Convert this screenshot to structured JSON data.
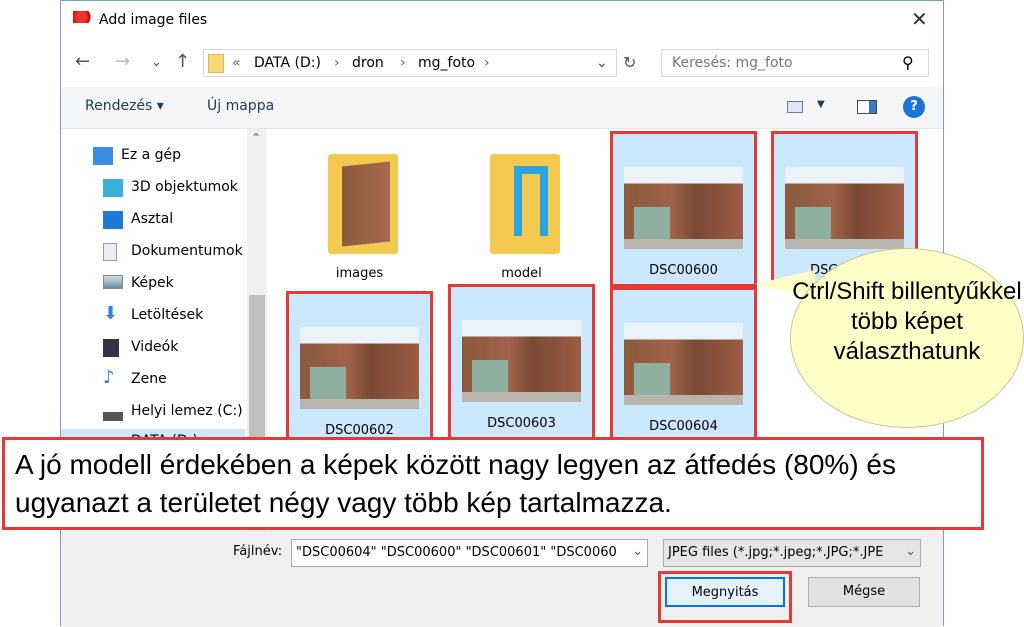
{
  "window": {
    "title": "Add image files",
    "close": "✕"
  },
  "nav": {
    "back": "←",
    "forward": "→",
    "recent": "⌄",
    "up": "↑",
    "breadcrumb": [
      "«",
      "DATA (D:)",
      "›",
      "dron",
      "›",
      "mg_foto",
      "›"
    ],
    "refresh": "↻",
    "dropdown": "⌄",
    "search_placeholder": "Keresés: mg_foto",
    "search_icon": "⚲"
  },
  "toolbar": {
    "organize": "Rendezés ▾",
    "new_folder": "Új mappa",
    "help": "?"
  },
  "sidebar": {
    "items": [
      {
        "label": "Ez a gép",
        "icon": "computer-icon"
      },
      {
        "label": "3D objektumok",
        "icon": "cube-icon"
      },
      {
        "label": "Asztal",
        "icon": "desktop-icon"
      },
      {
        "label": "Dokumentumok",
        "icon": "document-icon"
      },
      {
        "label": "Képek",
        "icon": "pictures-icon"
      },
      {
        "label": "Letöltések",
        "icon": "download-icon"
      },
      {
        "label": "Videók",
        "icon": "video-icon"
      },
      {
        "label": "Zene",
        "icon": "music-icon"
      },
      {
        "label": "Helyi lemez (C:)",
        "icon": "drive-icon"
      },
      {
        "label": "DATA (D:)",
        "icon": "drive-icon"
      }
    ]
  },
  "files": [
    {
      "name": "images",
      "type": "folder",
      "selected": false
    },
    {
      "name": "model",
      "type": "folder",
      "selected": false
    },
    {
      "name": "DSC00600",
      "type": "image",
      "selected": true
    },
    {
      "name": "DSC00601",
      "type": "image",
      "selected": true
    },
    {
      "name": "DSC00602",
      "type": "image",
      "selected": true
    },
    {
      "name": "DSC00603",
      "type": "image",
      "selected": true
    },
    {
      "name": "DSC00604",
      "type": "image",
      "selected": true
    }
  ],
  "callout": "Ctrl/Shift billentyűkkel több képet választhatunk",
  "annotation": "A jó modell érdekében a képek között nagy legyen az átfedés (80%) és ugyanazt a területet négy vagy több kép tartalmazza.",
  "footer": {
    "filename_label": "Fájlnév:",
    "filename_value": "\"DSC00604\" \"DSC00600\" \"DSC00601\" \"DSC0060",
    "filter": "JPEG files (*.jpg;*.jpeg;*.JPG;*.JPE",
    "open": "Megnyitás",
    "cancel": "Mégse"
  },
  "colors": {
    "highlight": "#e53935",
    "selection": "#cce8ff",
    "callout": "#ffffc8"
  }
}
